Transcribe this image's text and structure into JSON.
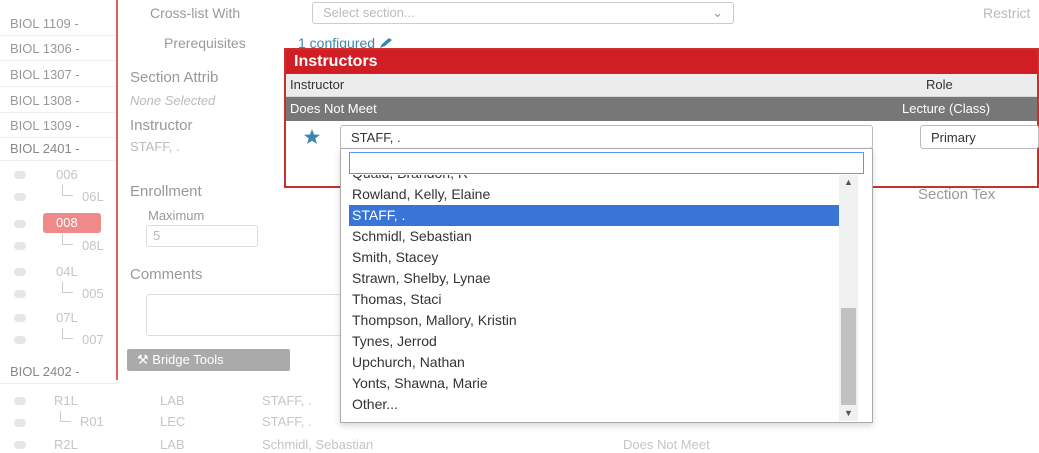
{
  "courses": [
    "BIOL 1109 -",
    "BIOL 1306 -",
    "BIOL 1307 -",
    "BIOL 1308 -",
    "BIOL 1309 -",
    "BIOL 2401 -",
    "BIOL 2402 -"
  ],
  "sections_2401": [
    {
      "top": "006",
      "sub": "06L"
    },
    {
      "top": "008",
      "sub": "08L",
      "highlight": true
    },
    {
      "top": "04L",
      "sub": "005"
    },
    {
      "top": "07L",
      "sub": "007"
    }
  ],
  "bottom_rows": [
    {
      "code": "R1L",
      "type": "LAB",
      "instructor": "STAFF, ."
    },
    {
      "code": "R01",
      "type": "LEC",
      "instructor": "STAFF, ."
    },
    {
      "code": "R2L",
      "type": "LAB",
      "instructor": "Schmidl, Sebastian",
      "meeting": "Does Not Meet"
    }
  ],
  "panel": {
    "cross_list_label": "Cross-list With",
    "cross_list_placeholder": "Select section...",
    "restrict_label": "Restrict",
    "prereq_label": "Prerequisites",
    "prereq_value": "1 configured",
    "attributes_label": "Section Attrib",
    "attributes_value": "None Selected",
    "instructor_label": "Instructor",
    "instructor_value": "STAFF, .",
    "enrollment_label": "Enrollment",
    "maximum_label": "Maximum",
    "maximum_value": "5",
    "comments_label": "Comments",
    "section_text_label": "Section Tex",
    "bridge_tools_label": "Bridge Tools"
  },
  "modal": {
    "title": "Instructors",
    "col_instructor": "Instructor",
    "col_role": "Role",
    "meeting_row": "Does Not Meet",
    "meeting_role": "Lecture (Class)",
    "selected_instructor": "STAFF, .",
    "role_value": "Primary"
  },
  "dropdown": {
    "search_value": "",
    "options": [
      "Quaid, Brandon, R",
      "Rowland, Kelly, Elaine",
      "STAFF, .",
      "Schmidl, Sebastian",
      "Smith, Stacey",
      "Strawn, Shelby, Lynae",
      "Thomas, Staci",
      "Thompson, Mallory, Kristin",
      "Tynes, Jerrod",
      "Upchurch, Nathan",
      "Yonts, Shawna, Marie",
      "Other..."
    ],
    "selected_index": 2
  },
  "colors": {
    "accent": "#d11d24",
    "selection": "#3875d7",
    "link": "#3a87ad"
  }
}
